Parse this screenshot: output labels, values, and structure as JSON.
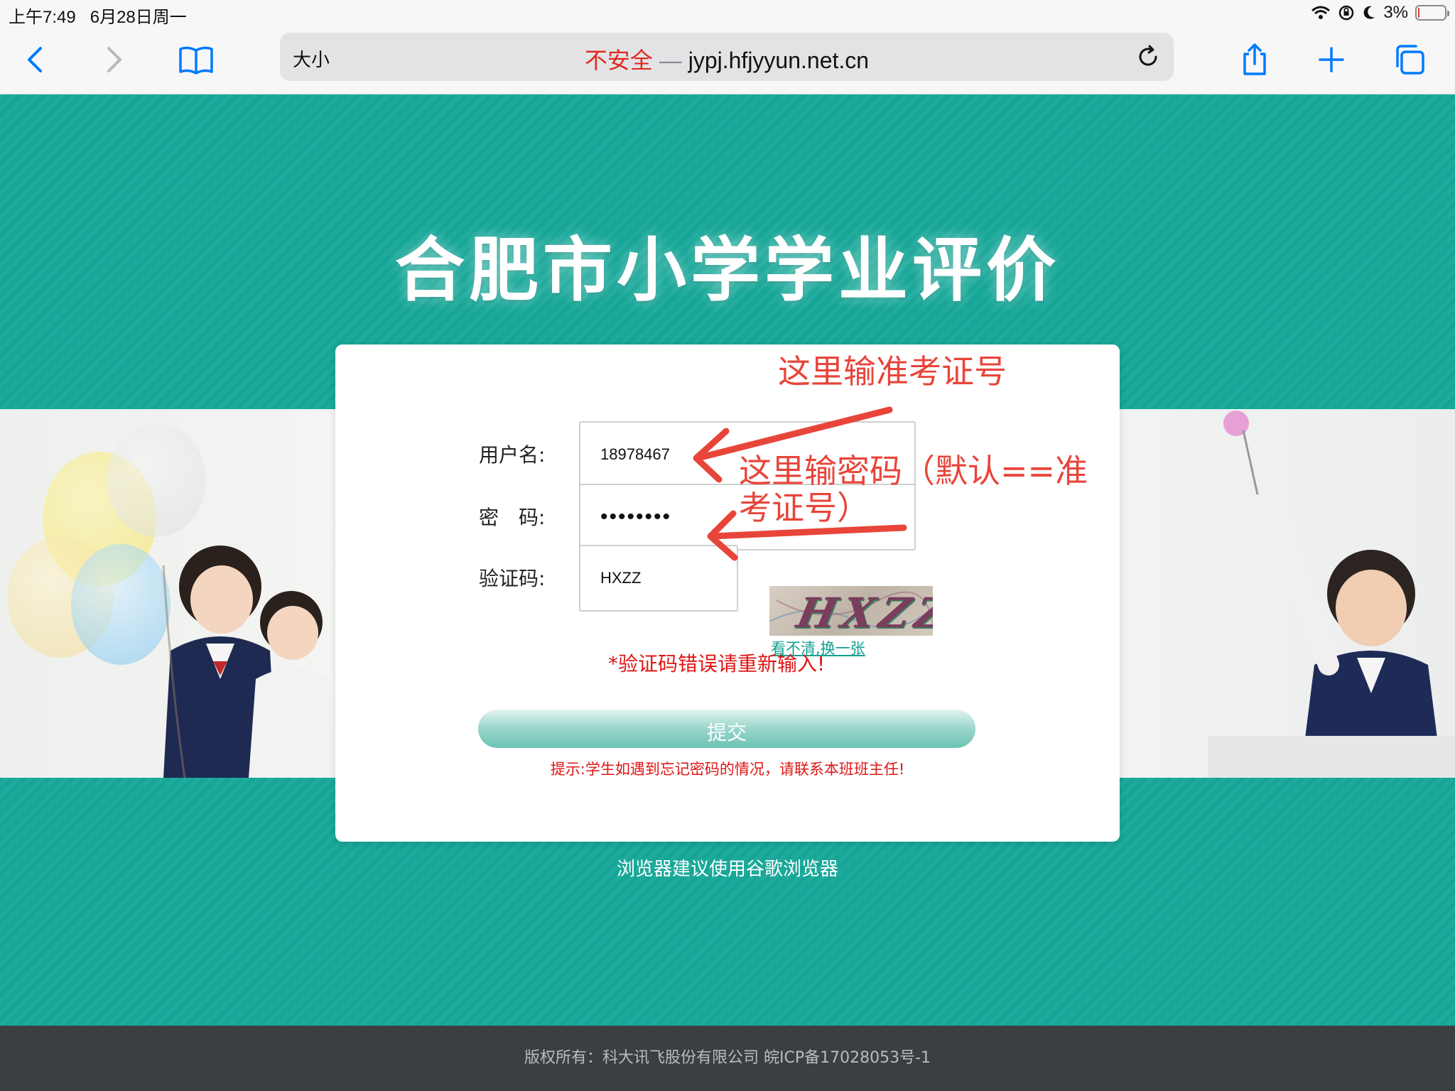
{
  "status_bar": {
    "time": "上午7:49",
    "date": "6月28日周一",
    "battery": "3%",
    "battery_level": 0.03
  },
  "safari": {
    "text_size_label": "大小",
    "security_label": "不安全",
    "separator": "—",
    "host": "jypj.hfjyyun.net.cn",
    "icons": [
      "back-icon",
      "forward-icon",
      "bookmarks-icon",
      "reload-icon",
      "share-icon",
      "new-tab-icon",
      "tabs-icon"
    ],
    "accent": "#007aff"
  },
  "page": {
    "title": "合肥市小学学业评价",
    "background_color": "#16a899"
  },
  "login_form": {
    "username_label": "用户名:",
    "username_value": "18978467",
    "password_label": "密　码:",
    "password_masked": "••••••••",
    "captcha_label": "验证码:",
    "captcha_value": "HXZZ",
    "captcha_image_text": "HXZZ",
    "captcha_refresh_link": "看不清,换一张",
    "error_message": "*验证码错误请重新输入!",
    "submit_label": "提交",
    "hint": "提示:学生如遇到忘记密码的情况，请联系本班班主任!"
  },
  "annotations": {
    "username_note": "这里输准考证号",
    "password_note_line1": "这里输密码（默认==准",
    "password_note_line2": "考证号）",
    "color": "#e8453a"
  },
  "browser_tip": "浏览器建议使用谷歌浏览器",
  "footer": {
    "copyright": "版权所有：科大讯飞股份有限公司 皖ICP备17028053号-1"
  }
}
